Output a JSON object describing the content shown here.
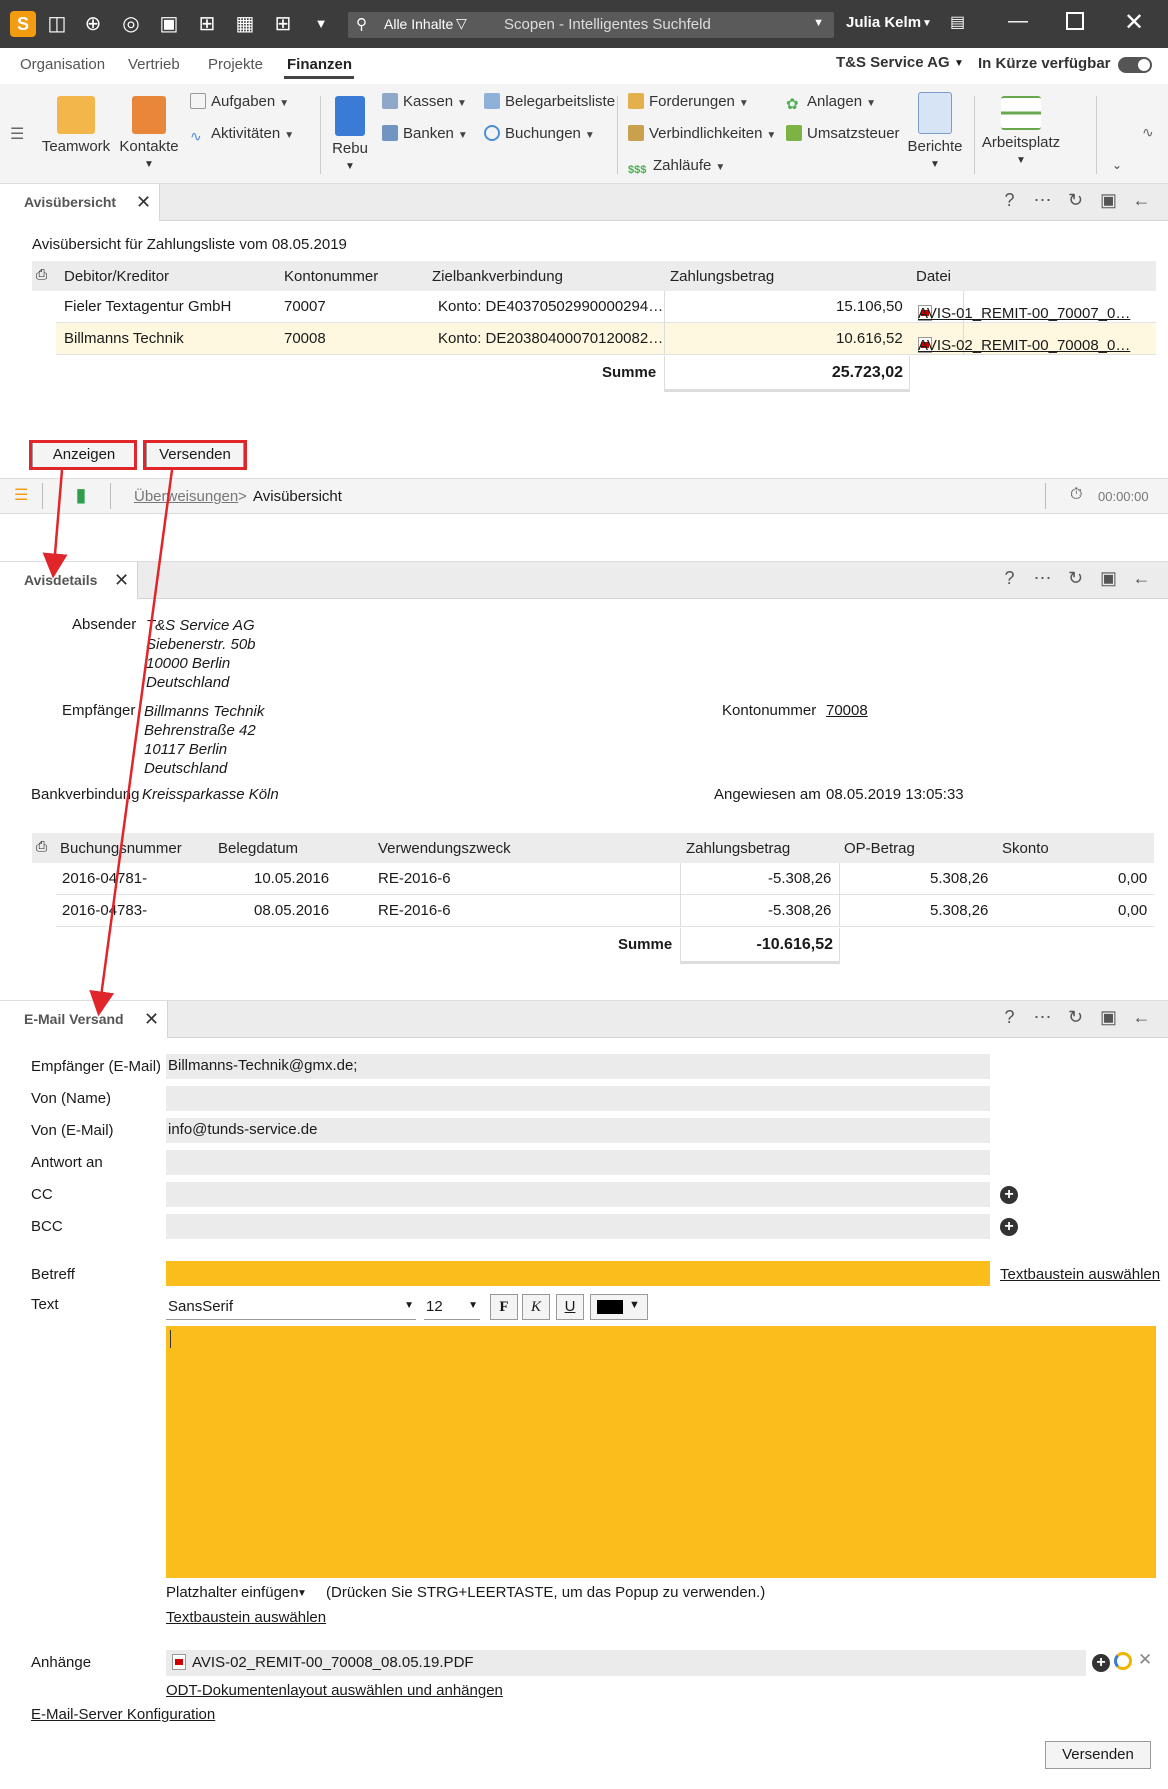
{
  "titlebar": {
    "search_scope": "Alle Inhalte",
    "search_placeholder": "Scopen - Intelligentes Suchfeld",
    "user": "Julia Kelm"
  },
  "menu": {
    "items": [
      "Organisation",
      "Vertrieb",
      "Projekte",
      "Finanzen"
    ],
    "active": "Finanzen",
    "company": "T&S Service AG",
    "soon": "In Kürze verfügbar"
  },
  "ribbon": {
    "teamwork": "Teamwork",
    "kontakte": "Kontakte",
    "aufgaben": "Aufgaben",
    "aktivitaeten": "Aktivitäten",
    "rebu": "Rebu",
    "kassen": "Kassen",
    "banken": "Banken",
    "belegarbeitsliste": "Belegarbeitsliste",
    "buchungen": "Buchungen",
    "forderungen": "Forderungen",
    "verbindlichkeiten": "Verbindlichkeiten",
    "zahllaeufe": "Zahläufe",
    "anlagen": "Anlagen",
    "umsatzsteuer": "Umsatzsteuer",
    "berichte": "Berichte",
    "arbeitsplatz": "Arbeitsplatz"
  },
  "avisuebersicht": {
    "tab": "Avisübersicht",
    "heading": "Avisübersicht für Zahlungsliste vom 08.05.2019",
    "columns": [
      "Debitor/Kreditor",
      "Kontonummer",
      "Zielbankverbindung",
      "Zahlungsbetrag",
      "Datei"
    ],
    "rows": [
      {
        "name": "Fieler Textagentur GmbH",
        "konto": "70007",
        "bank": "Konto: DE40370502990000294…",
        "betrag": "15.106,50",
        "datei": "AVIS-01_REMIT-00_70007_0…"
      },
      {
        "name": "Billmanns Technik",
        "konto": "70008",
        "bank": "Konto: DE20380400070120082…",
        "betrag": "10.616,52",
        "datei": "AVIS-02_REMIT-00_70008_0…"
      }
    ],
    "summe_label": "Summe",
    "summe": "25.723,02",
    "btn_anzeigen": "Anzeigen",
    "btn_versenden": "Versenden",
    "breadcrumb_parent": "Überweisungen",
    "breadcrumb_sep": ">",
    "breadcrumb_current": "Avisübersicht",
    "timer": "00:00:00"
  },
  "avisdetails": {
    "tab": "Avisdetails",
    "absender_label": "Absender",
    "absender": [
      "T&S Service AG",
      "Siebenerstr. 50b",
      "10000 Berlin",
      "Deutschland"
    ],
    "empfaenger_label": "Empfänger",
    "empfaenger": [
      "Billmanns Technik",
      "Behrenstraße 42",
      "10117 Berlin",
      "Deutschland"
    ],
    "kontonummer_label": "Kontonummer",
    "kontonummer": "70008",
    "bank_label": "Bankverbindung",
    "bank": "Kreissparkasse Köln",
    "angewiesen_label": "Angewiesen am",
    "angewiesen": "08.05.2019 13:05:33",
    "columns": [
      "Buchungsnummer",
      "Belegdatum",
      "Verwendungszweck",
      "Zahlungsbetrag",
      "OP-Betrag",
      "Skonto"
    ],
    "rows": [
      {
        "nr": "2016-04781-",
        "datum": "10.05.2016",
        "zweck": "RE-2016-6",
        "betrag": "-5.308,26",
        "op": "5.308,26",
        "skonto": "0,00"
      },
      {
        "nr": "2016-04783-",
        "datum": "08.05.2016",
        "zweck": "RE-2016-6",
        "betrag": "-5.308,26",
        "op": "5.308,26",
        "skonto": "0,00"
      }
    ],
    "summe_label": "Summe",
    "summe": "-10.616,52"
  },
  "email": {
    "tab": "E-Mail Versand",
    "labels": {
      "empfaenger": "Empfänger (E-Mail)",
      "von_name": "Von (Name)",
      "von_mail": "Von (E-Mail)",
      "antwort": "Antwort an",
      "cc": "CC",
      "bcc": "BCC",
      "betreff": "Betreff",
      "text": "Text",
      "anhaenge": "Anhänge"
    },
    "empfaenger": "Billmanns-Technik@gmx.de;",
    "von_name": "",
    "von_mail": "info@tunds-service.de",
    "antwort": "",
    "cc": "",
    "bcc": "",
    "textbaustein": "Textbaustein auswählen",
    "font": "SansSerif",
    "size": "12",
    "bold": "F",
    "italic": "K",
    "underline": "U",
    "platzhalter": "Platzhalter einfügen",
    "platzhalter_hint": "(Drücken Sie STRG+LEERTASTE, um das Popup zu verwenden.)",
    "textbaustein2": "Textbaustein auswählen",
    "attachment": "AVIS-02_REMIT-00_70008_08.05.19.PDF",
    "odt_link": "ODT-Dokumentenlayout auswählen und anhängen",
    "server_link": "E-Mail-Server Konfiguration",
    "send": "Versenden"
  },
  "colors": {
    "highlight": "#fbbd1b",
    "selected_row": "#fff8e1",
    "annotation_red": "#e0262b",
    "titlebar": "#3c3c3c"
  }
}
